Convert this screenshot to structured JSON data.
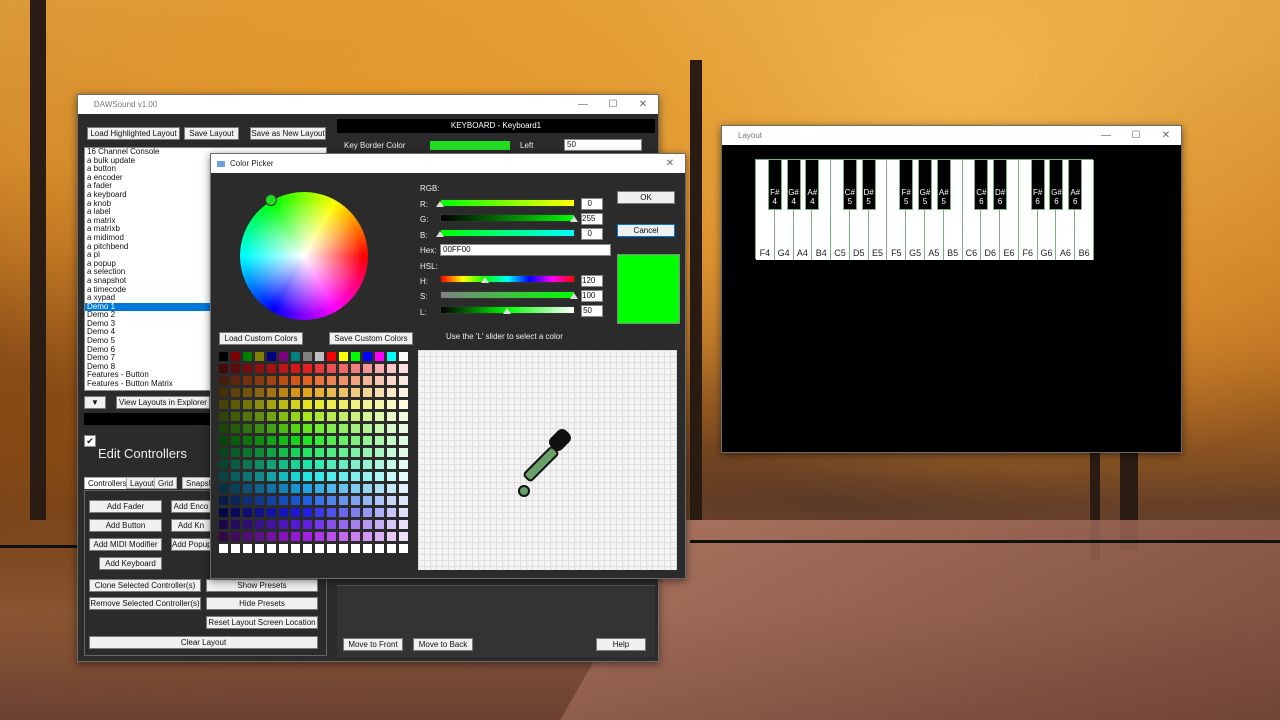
{
  "daw_window": {
    "title": "DAWSound  v1.00",
    "top_buttons": [
      "Load Highlighted Layout",
      "Save Layout",
      "Save as New Layout"
    ],
    "layouts": [
      "16 Channel Console",
      "a bulk update",
      "a button",
      "a encoder",
      "a fader",
      "a keyboard",
      "a knob",
      "a label",
      "a matrix",
      "a matrixb",
      "a midimod",
      "a pitchbend",
      "a pl",
      "a popup",
      "a selection",
      "a snapshot",
      "a timecode",
      "a xypad",
      "Demo 1",
      "Demo 2",
      "Demo 3",
      "Demo 4",
      "Demo 5",
      "Demo 6",
      "Demo 7",
      "Demo 8",
      "Features - Button",
      "Features - Button Matrix"
    ],
    "selected_layout": "Demo 1",
    "dropdown_arrow": "▼",
    "view_explorer": "View Layouts in Explorer",
    "edit_controllers_label": "Edit Controllers",
    "tabs": [
      "Controllers",
      "Layout",
      "Grid",
      "Snapsh"
    ],
    "buttons": {
      "add_fader": "Add Fader",
      "add_encoder": "Add Enco",
      "add_button": "Add Button",
      "add_knob": "Add Kn",
      "add_midi_modifier": "Add MIDI Modifier",
      "add_popup": "Add Popup",
      "add_keyboard": "Add Keyboard",
      "clone": "Clone Selected Controller(s)",
      "show_presets": "Show Presets",
      "remove": "Remove Selected Controller(s)",
      "hide_presets": "Hide Presets",
      "reset_location": "Reset Layout Screen Location",
      "clear_layout": "Clear Layout",
      "move_front": "Move to Front",
      "move_back": "Move to Back",
      "help": "Help"
    },
    "props_header": "KEYBOARD  -  Keyboard1",
    "key_border_label": "Key Border Color",
    "key_border_color": "#22dd22",
    "left_label": "Left",
    "left_value": "50"
  },
  "color_picker": {
    "title": "Color Picker",
    "rgb_label": "RGB:",
    "r_label": "R:",
    "g_label": "G:",
    "b_label": "B:",
    "r_value": "0",
    "g_value": "255",
    "b_value": "0",
    "hex_label": "Hex:",
    "hex_value": "00FF00",
    "hsl_label": "HSL:",
    "h_label": "H:",
    "s_label": "S:",
    "l_label": "L:",
    "h_value": "120",
    "s_value": "100",
    "l_value": "50",
    "ok": "OK",
    "cancel": "Cancel",
    "load_custom": "Load Custom Colors",
    "save_custom": "Save Custom Colors",
    "hint": "Use the 'L' slider to select a color",
    "preview_color": "#00ff00",
    "basic_colors": [
      "#000000",
      "#7f0000",
      "#007f00",
      "#7f7f00",
      "#00007f",
      "#7f007f",
      "#007f7f",
      "#7f7f7f",
      "#c0c0c0",
      "#ff0000",
      "#ffff00",
      "#00ff00",
      "#0000ff",
      "#ff00ff",
      "#00ffff",
      "#ffffff"
    ]
  },
  "layout_window": {
    "title": "Layout",
    "white_keys": [
      "F4",
      "G4",
      "A4",
      "B4",
      "C5",
      "D5",
      "E5",
      "F5",
      "G5",
      "A5",
      "B5",
      "C6",
      "D6",
      "E6",
      "F6",
      "G6",
      "A6",
      "B6"
    ],
    "black_keys": [
      "F#\n4",
      "G#\n4",
      "A#\n4",
      "C#\n5",
      "D#\n5",
      "F#\n5",
      "G#\n5",
      "A#\n5",
      "C#\n6",
      "D#\n6",
      "F#\n6",
      "G#\n6",
      "A#\n6"
    ]
  }
}
